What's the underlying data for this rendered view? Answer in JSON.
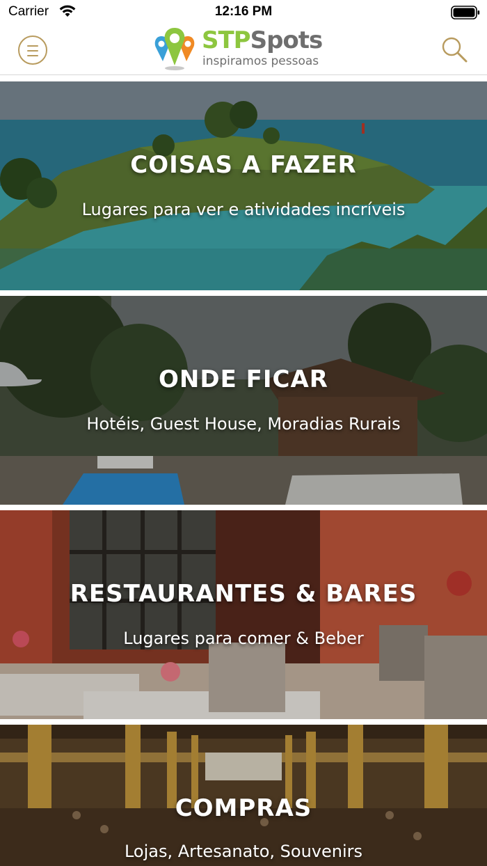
{
  "status_bar": {
    "carrier": "Carrier",
    "time": "12:16 PM"
  },
  "header": {
    "logo_brand_part1": "STP",
    "logo_brand_part2": "Spots",
    "logo_tagline": "inspiramos pessoas",
    "menu_icon": "hamburger-menu-icon",
    "search_icon": "search-icon",
    "accent_color": "#b89b5e",
    "brand_green": "#8dc63f"
  },
  "categories": [
    {
      "title": "COISAS A FAZER",
      "subtitle": "Lugares para ver e atividades incríveis"
    },
    {
      "title": "ONDE FICAR",
      "subtitle": "Hotéis, Guest House, Moradias Rurais"
    },
    {
      "title": "RESTAURANTES & BARES",
      "subtitle": "Lugares para comer & Beber"
    },
    {
      "title": "COMPRAS",
      "subtitle": "Lojas, Artesanato, Souvenirs"
    }
  ]
}
